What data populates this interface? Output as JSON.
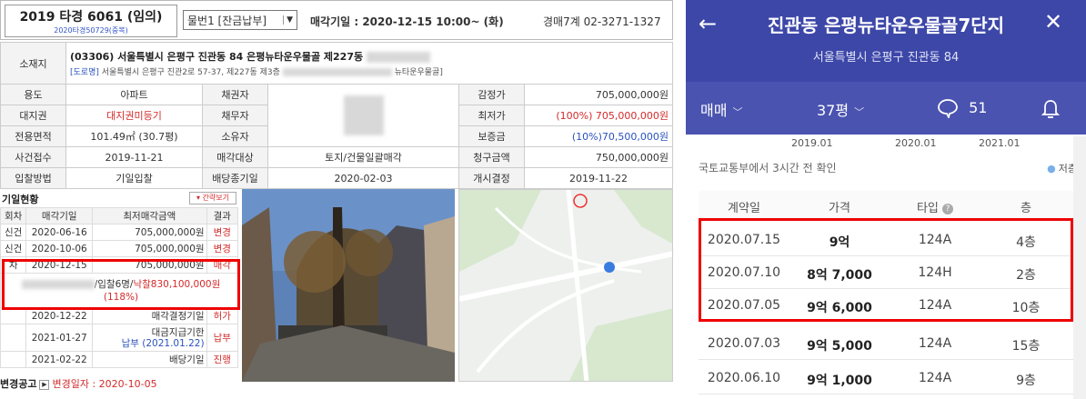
{
  "auction": {
    "case_title": "2019 타경 6061 (임의)",
    "case_sub": "2020타경50729(중복)",
    "item_select": "물번1 [잔금납부]",
    "sale_date": "매각기일 : 2020-12-15 10:00~ (화)",
    "court": "경매7계 02-3271-1327",
    "location_label": "소재지",
    "address_zip": "(03306)",
    "address_main": "서울특별시 은평구 진관동 84 은평뉴타운우물골 제227동",
    "address_road_tag": "[도로명]",
    "address_road": "서울특별시 은평구 진관2로 57-37, 제227동 제3층",
    "address_road_tail": "뉴타운우물골]",
    "rows": [
      {
        "l1": "용도",
        "v1": "아파트",
        "l2": "채권자",
        "v2": "",
        "l3": "감정가",
        "v3": "705,000,000원"
      },
      {
        "l1": "대지권",
        "v1": "대지권미등기",
        "l2": "채무자",
        "v2": "",
        "l3": "최저가",
        "v3": "(100%) 705,000,000원"
      },
      {
        "l1": "전용면적",
        "v1": "101.49㎡ (30.7평)",
        "l2": "소유자",
        "v2": "",
        "l3": "보증금",
        "v3": "(10%)70,500,000원"
      },
      {
        "l1": "사건접수",
        "v1": "2019-11-21",
        "l2": "매각대상",
        "v2": "토지/건물일괄매각",
        "l3": "청구금액",
        "v3": "750,000,000원"
      },
      {
        "l1": "입찰방법",
        "v1": "기일입찰",
        "l2": "배당종기일",
        "v2": "2020-02-03",
        "l3": "개시결정",
        "v3": "2019-11-22"
      }
    ],
    "history_title": "기일현황",
    "brief_button": "간략보기",
    "history_headers": [
      "회차",
      "매각기일",
      "최저매각금액",
      "결과"
    ],
    "history": [
      {
        "round": "신건",
        "date": "2020-06-16",
        "amount": "705,000,000원",
        "result": "변경"
      },
      {
        "round": "신건",
        "date": "2020-10-06",
        "amount": "705,000,000원",
        "result": "변경"
      },
      {
        "round": "차",
        "date": "2020-12-15",
        "amount": "705,000,000원",
        "result": "매각"
      }
    ],
    "bid_text_a": "/입찰6명/",
    "bid_text_b": "낙찰830,100,000원",
    "bid_pct": "(118%)",
    "history_after": [
      {
        "date": "2020-12-22",
        "desc": "매각결정기일",
        "result": "허가"
      },
      {
        "date": "2021-01-27",
        "desc": "대금지급기한",
        "desc2": "납부 (2021.01.22)",
        "result": "납부"
      },
      {
        "date": "2021-02-22",
        "desc": "배당기일",
        "result": "진행"
      }
    ],
    "notice_title": "변경공고",
    "notice_text": "변경일자 : 2020-10-05"
  },
  "mobile": {
    "title": "진관동 은평뉴타운우물골7단지",
    "subtitle": "서울특별시 은평구 진관동 84",
    "deal_type": "매매",
    "size": "37평",
    "comments": "51",
    "years": [
      "2019.01",
      "2020.01",
      "2021.01"
    ],
    "confirm_text": "국토교통부에서 3시간 전 확인",
    "legend": "저층",
    "headers": [
      "계약일",
      "가격",
      "타입",
      "층"
    ],
    "trades": [
      {
        "date": "2020.07.15",
        "price": "9억",
        "type": "124A",
        "floor": "4층"
      },
      {
        "date": "2020.07.10",
        "price": "8억 7,000",
        "type": "124H",
        "floor": "2층"
      },
      {
        "date": "2020.07.05",
        "price": "9억 6,000",
        "type": "124A",
        "floor": "10층"
      },
      {
        "date": "2020.07.03",
        "price": "9억 5,000",
        "type": "124A",
        "floor": "15층"
      },
      {
        "date": "2020.06.10",
        "price": "9억 1,000",
        "type": "124A",
        "floor": "9층"
      }
    ],
    "colors": {
      "header": "#3d47a8",
      "bar": "#4a53b0",
      "highlight": "#e00000"
    }
  }
}
